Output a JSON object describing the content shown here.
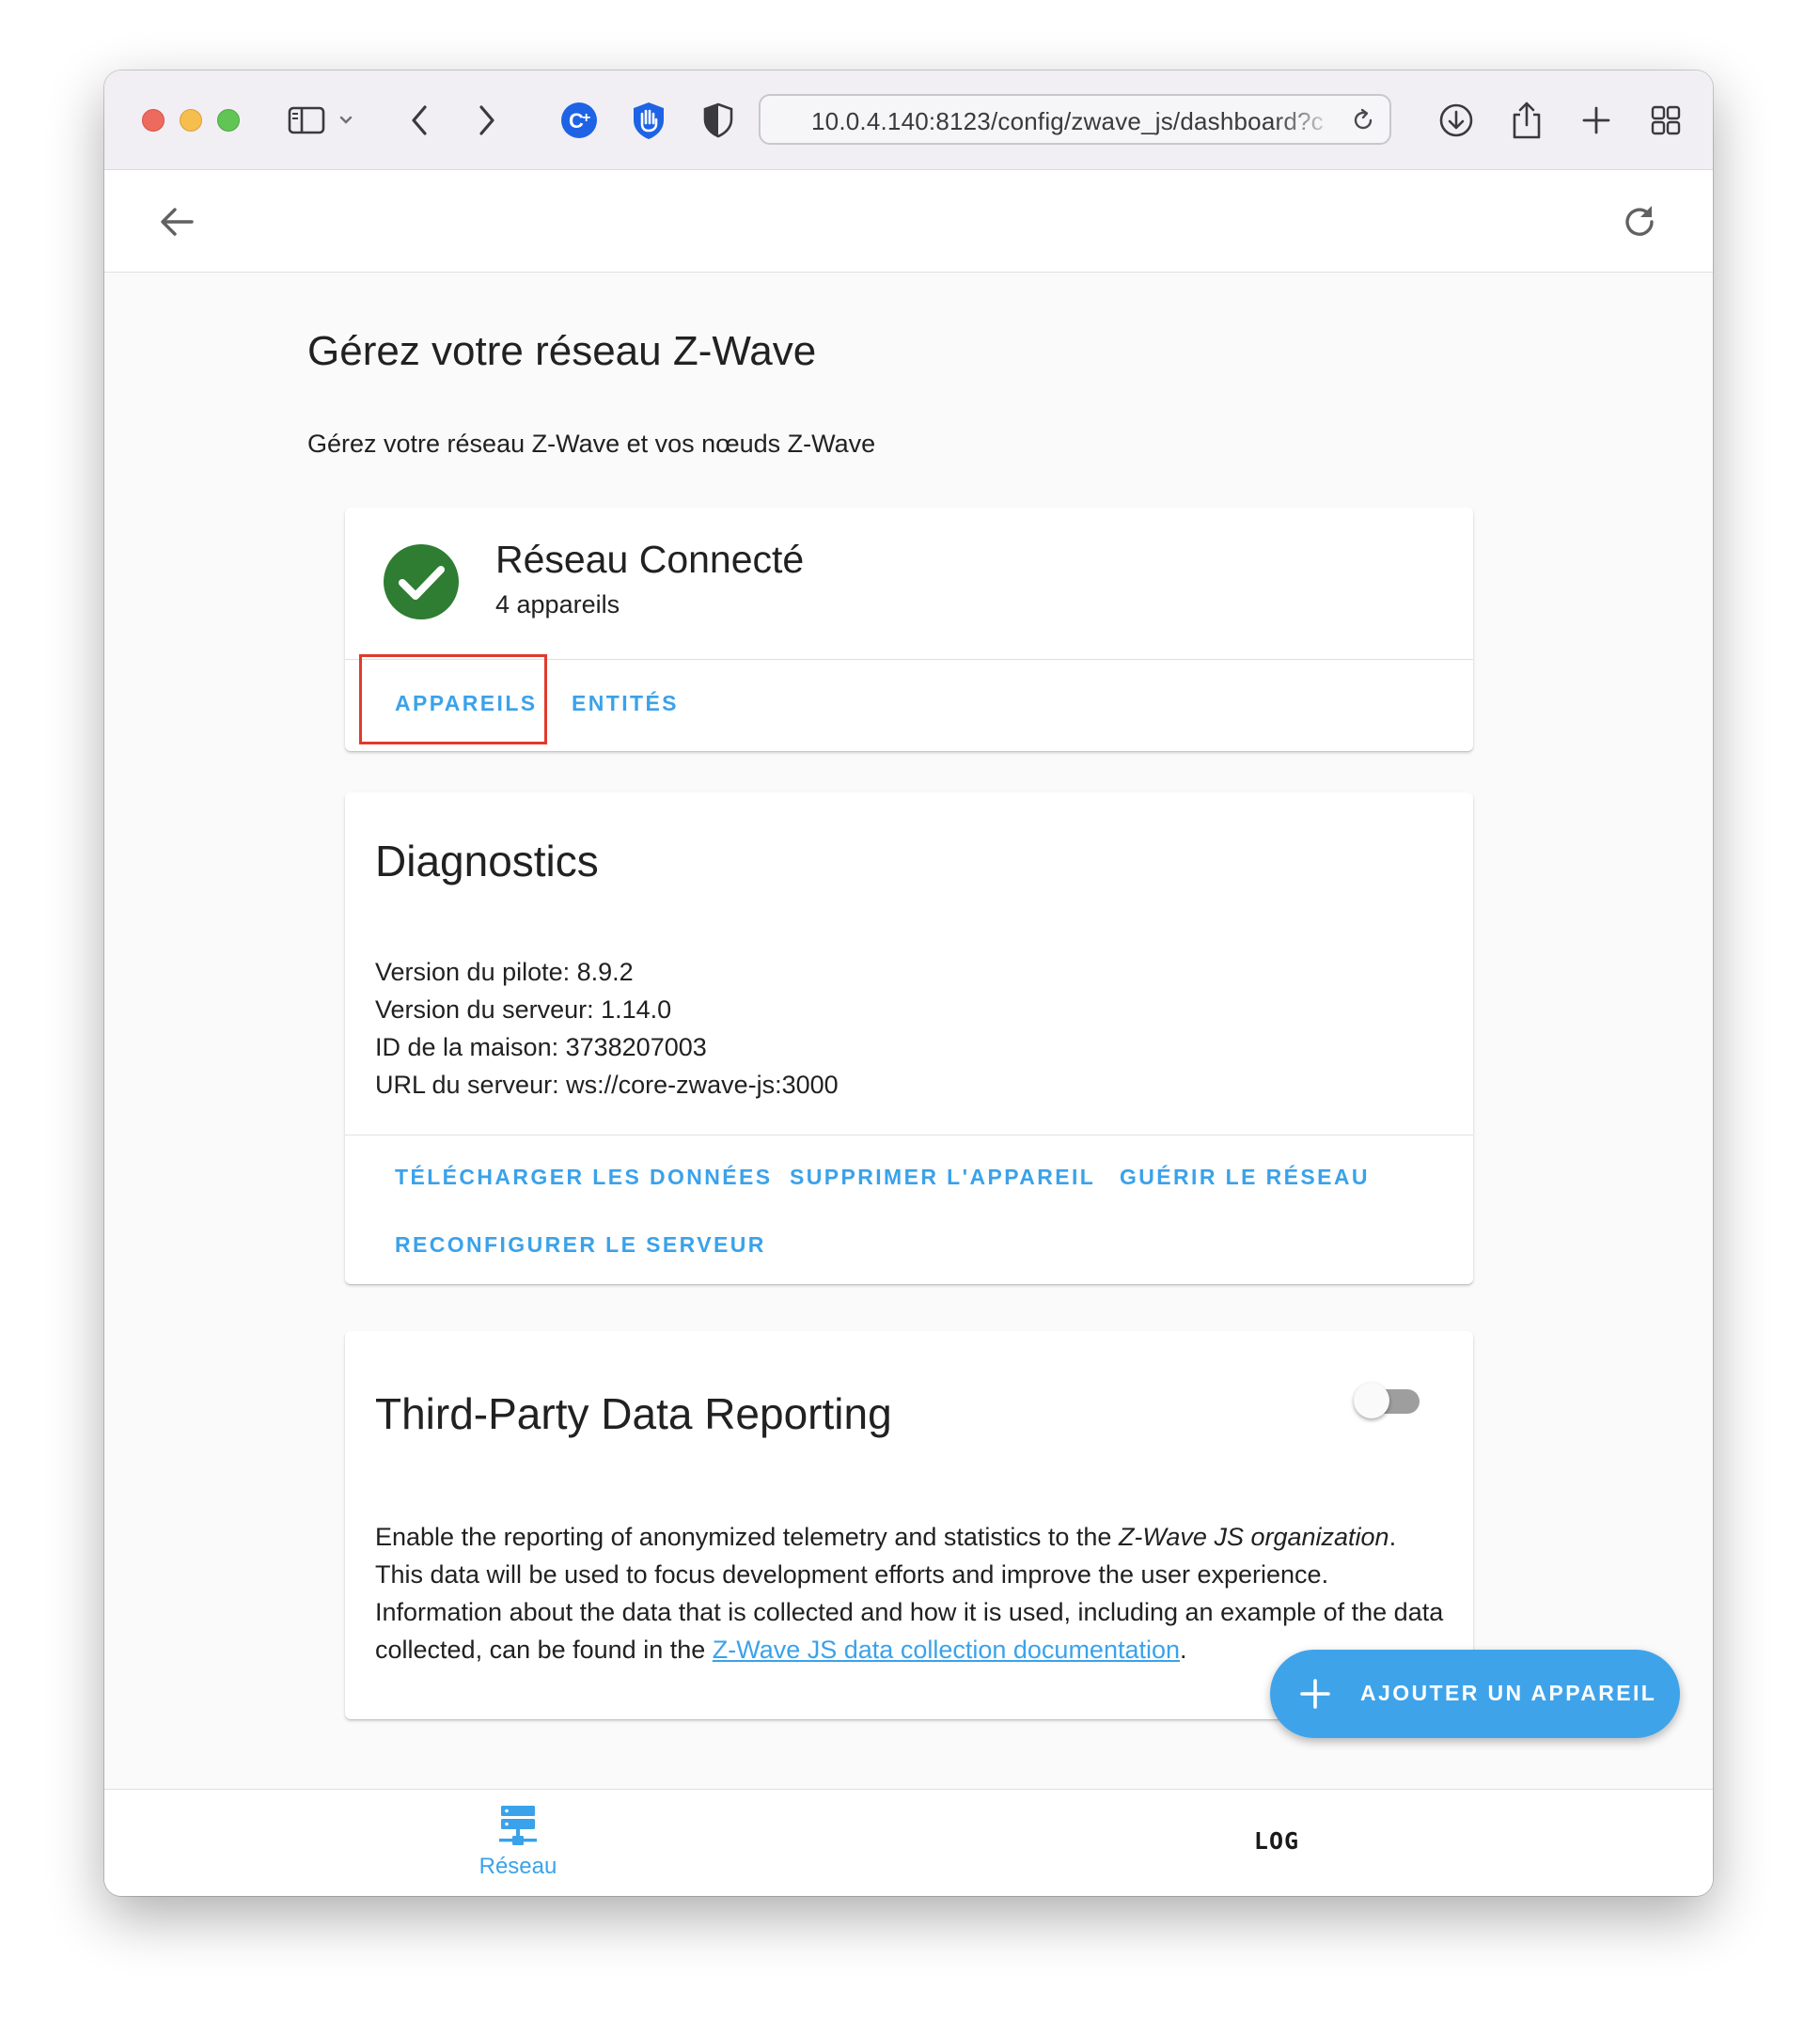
{
  "browser": {
    "url": "10.0.4.140:8123/config/zwave_js/dashboard?c"
  },
  "page": {
    "title": "Gérez votre réseau Z-Wave",
    "subtitle": "Gérez votre réseau Z-Wave et vos nœuds Z-Wave"
  },
  "network_card": {
    "status_title": "Réseau Connecté",
    "device_count": "4 appareils",
    "status_color": "#2e7d32",
    "actions": [
      "APPAREILS",
      "ENTITÉS"
    ]
  },
  "diagnostics": {
    "title": "Diagnostics",
    "lines": [
      "Version du pilote: 8.9.2",
      "Version du serveur: 1.14.0",
      "ID de la maison: 3738207003",
      "URL du serveur: ws://core-zwave-js:3000"
    ],
    "actions": [
      "TÉLÉCHARGER LES DONNÉES",
      "SUPPRIMER L'APPAREIL",
      "GUÉRIR LE RÉSEAU",
      "RECONFIGURER LE SERVEUR"
    ]
  },
  "third_party": {
    "title": "Third-Party Data Reporting",
    "toggle_on": false,
    "text_1": "Enable the reporting of anonymized telemetry and statistics to the ",
    "text_italic": "Z-Wave JS organization",
    "text_2": ". This data will be used to focus development efforts and improve the user experience. Information about the data that is collected and how it is used, including an example of the data collected, can be found in the ",
    "link_text": "Z-Wave JS data collection documentation",
    "text_3": "."
  },
  "fab": {
    "label": "AJOUTER UN APPAREIL"
  },
  "bottom_nav": {
    "reseau_label": "Réseau",
    "log_label": "LOG"
  },
  "colors": {
    "accent": "#3aa2ea",
    "highlight": "#e03a2c"
  }
}
